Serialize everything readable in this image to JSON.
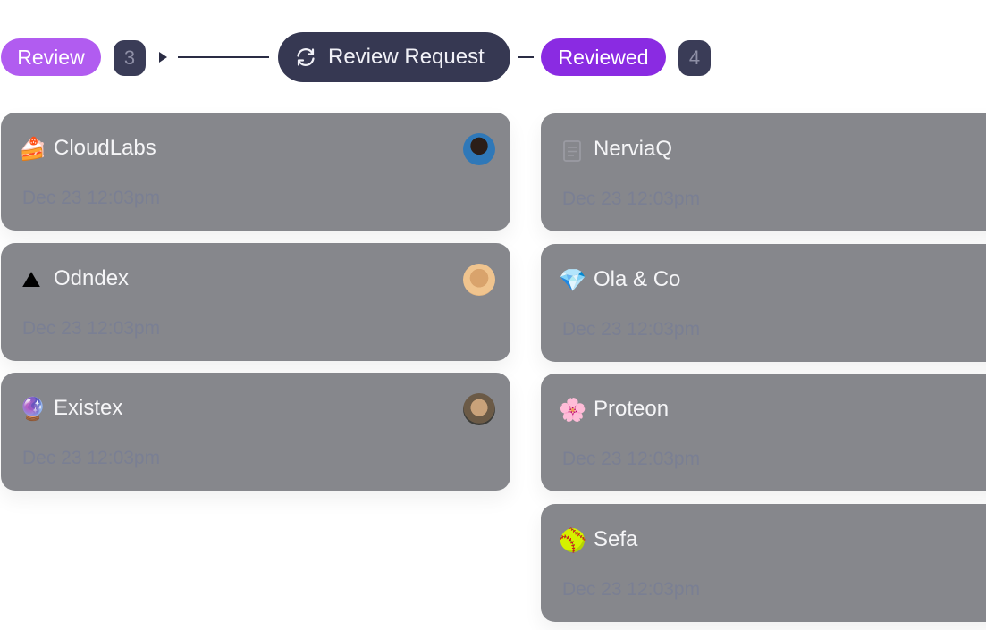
{
  "workflow": {
    "review_label": "Review",
    "review_count": "3",
    "request_label": "Review Request",
    "reviewed_label": "Reviewed",
    "reviewed_count": "4",
    "colors": {
      "review": "#b15cf0",
      "reviewed": "#8a2be2",
      "dark": "#363852"
    }
  },
  "review_cards": [
    {
      "emoji": "🍰",
      "name": "CloudLabs",
      "date": "Dec 23 12:03pm",
      "avatar": "avatar-1"
    },
    {
      "emoji": "⛰",
      "name": "Odndex",
      "date": "Dec 23 12:03pm",
      "avatar": "avatar-2"
    },
    {
      "emoji": "🔮",
      "name": "Existex",
      "date": "Dec 23 12:03pm",
      "avatar": "avatar-3"
    }
  ],
  "reviewed_cards": [
    {
      "icon": "document-icon",
      "name": "NerviaQ",
      "date": "Dec 23 12:03pm"
    },
    {
      "emoji": "💎",
      "name": "Ola & Co",
      "date": "Dec 23 12:03pm"
    },
    {
      "emoji": "🌸",
      "name": "Proteon",
      "date": "Dec 23 12:03pm"
    },
    {
      "emoji": "🥎",
      "name": "Sefa",
      "date": "Dec 23 12:03pm"
    }
  ]
}
